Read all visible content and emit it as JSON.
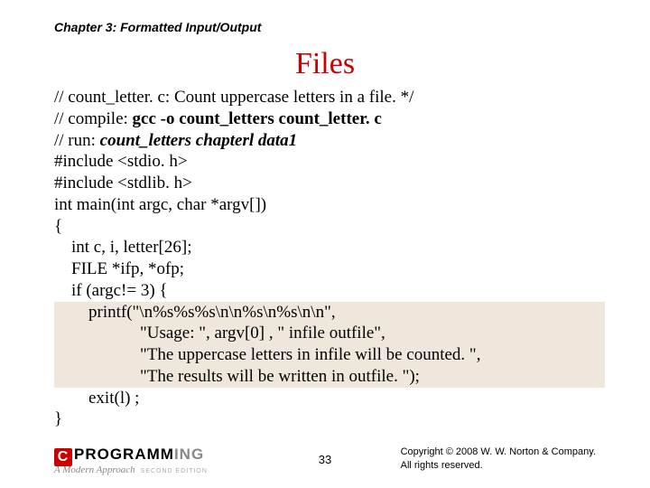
{
  "chapter_header": "Chapter 3: Formatted Input/Output",
  "title": "Files",
  "code": {
    "l1": "// count_letter. c: Count uppercase letters in a file. */",
    "l2_a": "// compile: ",
    "l2_b": "gcc -o count_letters count_letter. c",
    "l3_a": "// run: ",
    "l3_b": "count_letters chapterl data1",
    "l4": "#include <stdio. h>",
    "l5": "#include <stdlib. h>",
    "l6": "int main(int argc, char *argv[])",
    "l7": "{",
    "l8": "int c, i, letter[26];",
    "l9": "FILE *ifp, *ofp;",
    "l10": "if (argc!= 3) {",
    "l11": "printf(\"\\n%s%s%s\\n\\n%s\\n%s\\n\\n\",",
    "l12a": "\"Usage: \", argv[0] , \" infile outfile\",",
    "l12b": "\"The uppercase letters in infile will be counted. \",",
    "l12c": "\"The results will be written in outfile. \");",
    "l13": "exit(l) ;",
    "l14": "}"
  },
  "logo": {
    "c": "C",
    "prog": "PROGRAMM",
    "ing": "ING",
    "sub": "A Modern Approach",
    "ed": "SECOND EDITION"
  },
  "page_num": "33",
  "copyright_l1": "Copyright © 2008 W. W. Norton & Company.",
  "copyright_l2": "All rights reserved."
}
